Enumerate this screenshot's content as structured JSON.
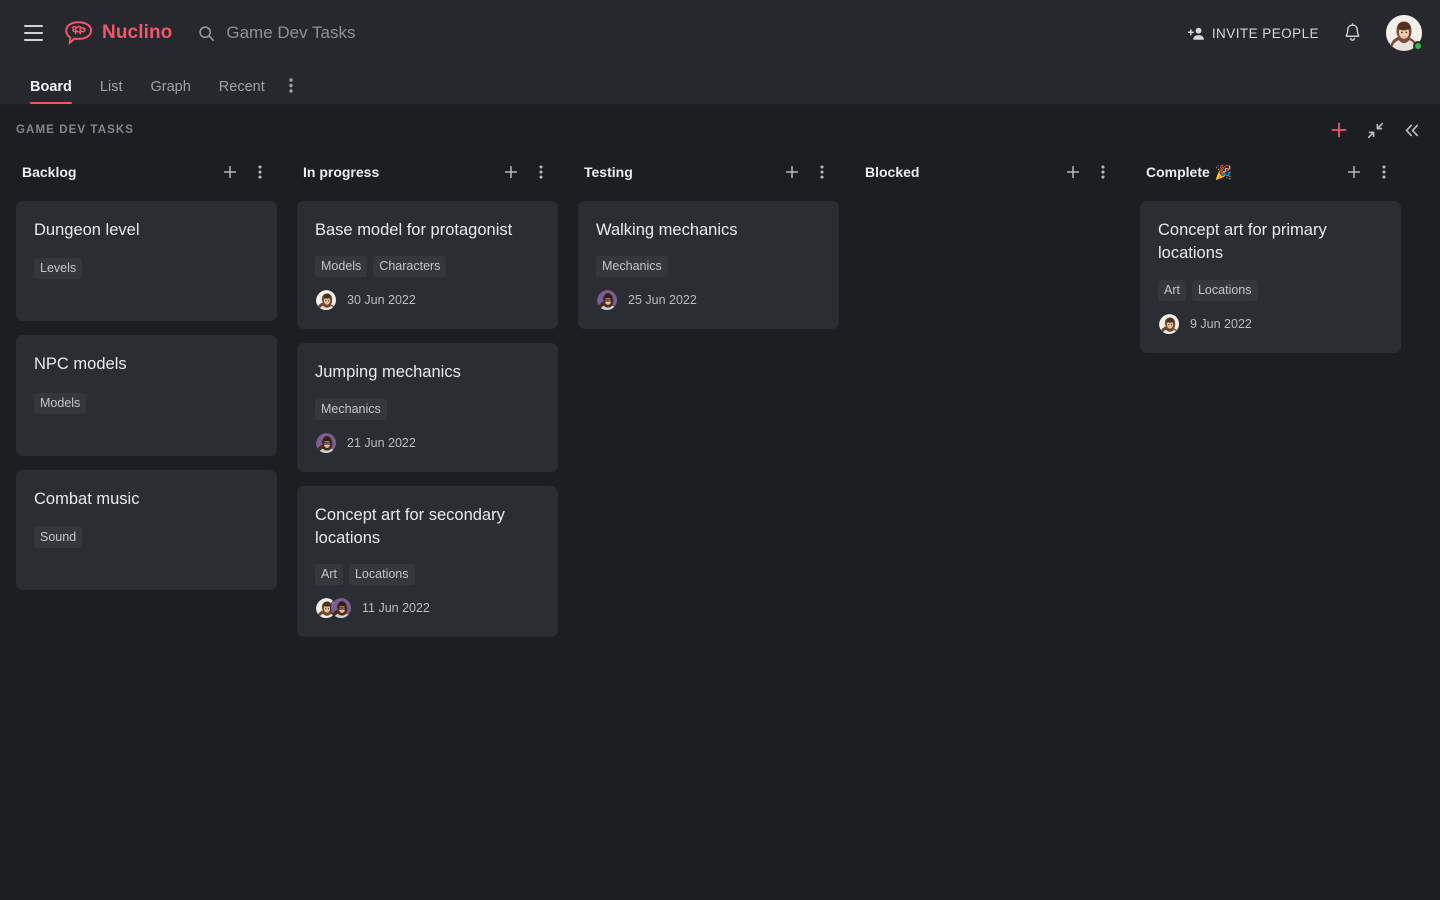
{
  "header": {
    "menu_label": "menu",
    "brand_name": "Nuclino",
    "search_value": "Game Dev Tasks",
    "search_placeholder": "Search",
    "invite_label": "INVITE PEOPLE",
    "notifications_label": "Notifications",
    "avatar_label": "User avatar",
    "status": "online"
  },
  "tabs": [
    {
      "label": "Board",
      "active": true
    },
    {
      "label": "List",
      "active": false
    },
    {
      "label": "Graph",
      "active": false
    },
    {
      "label": "Recent",
      "active": false
    }
  ],
  "tabs_more_label": "More views",
  "subbar": {
    "breadcrumb": "GAME DEV TASKS",
    "tools": [
      {
        "name": "add-item-button",
        "label": "Add"
      },
      {
        "name": "collapse-columns-button",
        "label": "Collapse"
      },
      {
        "name": "collapse-sidebar-button",
        "label": "Hide panel"
      }
    ]
  },
  "colors": {
    "accent": "#f2566a",
    "page_bg": "#1c1f22",
    "header_bg": "#26282d",
    "card_bg": "#2a2d31",
    "tag_bg": "#34383d",
    "online": "#2fbb3e"
  },
  "board": {
    "columns": [
      {
        "title": "Backlog",
        "emoji": "",
        "cards": [
          {
            "title": "Dungeon level",
            "tags": [
              "Levels"
            ],
            "date": "",
            "avatars": []
          },
          {
            "title": "NPC models",
            "tags": [
              "Models"
            ],
            "date": "",
            "avatars": []
          },
          {
            "title": "Combat music",
            "tags": [
              "Sound"
            ],
            "date": "",
            "avatars": []
          }
        ]
      },
      {
        "title": "In progress",
        "emoji": "",
        "cards": [
          {
            "title": "Base model for protagonist",
            "tags": [
              "Models",
              "Characters"
            ],
            "date": "30 Jun 2022",
            "avatars": [
              "man"
            ]
          },
          {
            "title": "Jumping mechanics",
            "tags": [
              "Mechanics"
            ],
            "date": "21 Jun 2022",
            "avatars": [
              "woman-glasses"
            ]
          },
          {
            "title": "Concept art for secondary locations",
            "tags": [
              "Art",
              "Locations"
            ],
            "date": "11 Jun 2022",
            "avatars": [
              "man",
              "woman-glasses"
            ]
          }
        ]
      },
      {
        "title": "Testing",
        "emoji": "",
        "cards": [
          {
            "title": "Walking mechanics",
            "tags": [
              "Mechanics"
            ],
            "date": "25 Jun 2022",
            "avatars": [
              "woman-glasses"
            ]
          }
        ]
      },
      {
        "title": "Blocked",
        "emoji": "",
        "cards": []
      },
      {
        "title": "Complete",
        "emoji": "🎉",
        "cards": [
          {
            "title": "Concept art for primary locations",
            "tags": [
              "Art",
              "Locations"
            ],
            "date": "9 Jun 2022",
            "avatars": [
              "man"
            ]
          }
        ]
      }
    ]
  }
}
